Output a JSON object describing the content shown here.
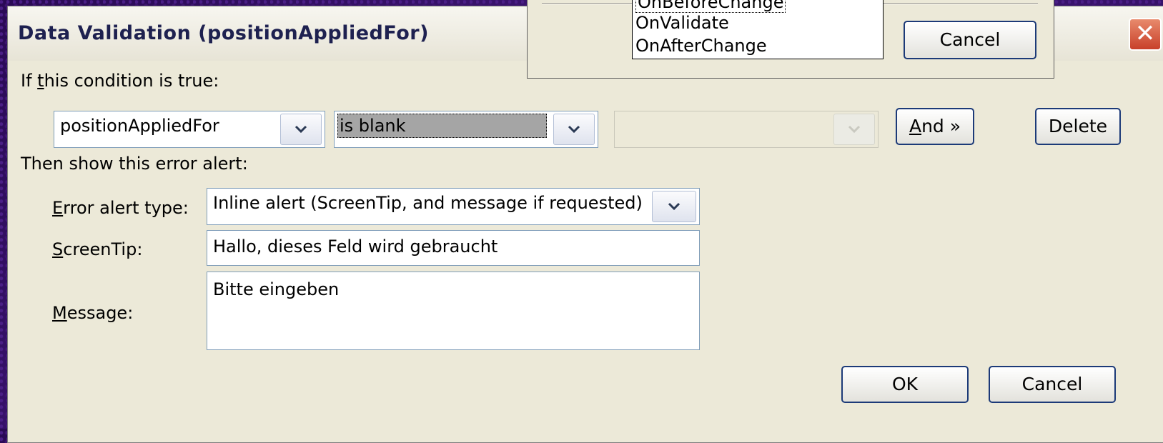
{
  "dialog": {
    "title": "Data Validation (positionAppliedFor)",
    "condition_label_pre": "If ",
    "condition_label_u": "t",
    "condition_label_post": "his condition is true:",
    "field_combo": {
      "value": "positionAppliedFor"
    },
    "operator_combo": {
      "value": "is blank"
    },
    "value_combo": {
      "value": ""
    },
    "and_button_u": "A",
    "and_button_rest": "nd »",
    "delete_button": "Delete",
    "alert_section_label": "Then show this error alert:",
    "error_type_label_u": "E",
    "error_type_label_rest": "rror alert type:",
    "error_type_value": "Inline alert (ScreenTip, and message if requested)",
    "screentip_label_u": "S",
    "screentip_label_rest": "creenTip:",
    "screentip_value": "Hallo, dieses Feld wird gebraucht",
    "message_label_u": "M",
    "message_label_rest": "essage:",
    "message_value": "Bitte eingeben",
    "ok_button": "OK",
    "cancel_button": "Cancel"
  },
  "popup": {
    "events": [
      "OnBeforeChange",
      "OnValidate",
      "OnAfterChange"
    ],
    "cancel_button": "Cancel"
  },
  "colors": {
    "title_text": "#1e2150",
    "close_button": "#c8402a",
    "dialog_bg": "#ece9d8",
    "selection_bg": "#a5a5a5",
    "button_border": "#1c3a78"
  },
  "icons": {
    "close": "close-icon",
    "dropdown": "chevron-down-icon"
  }
}
